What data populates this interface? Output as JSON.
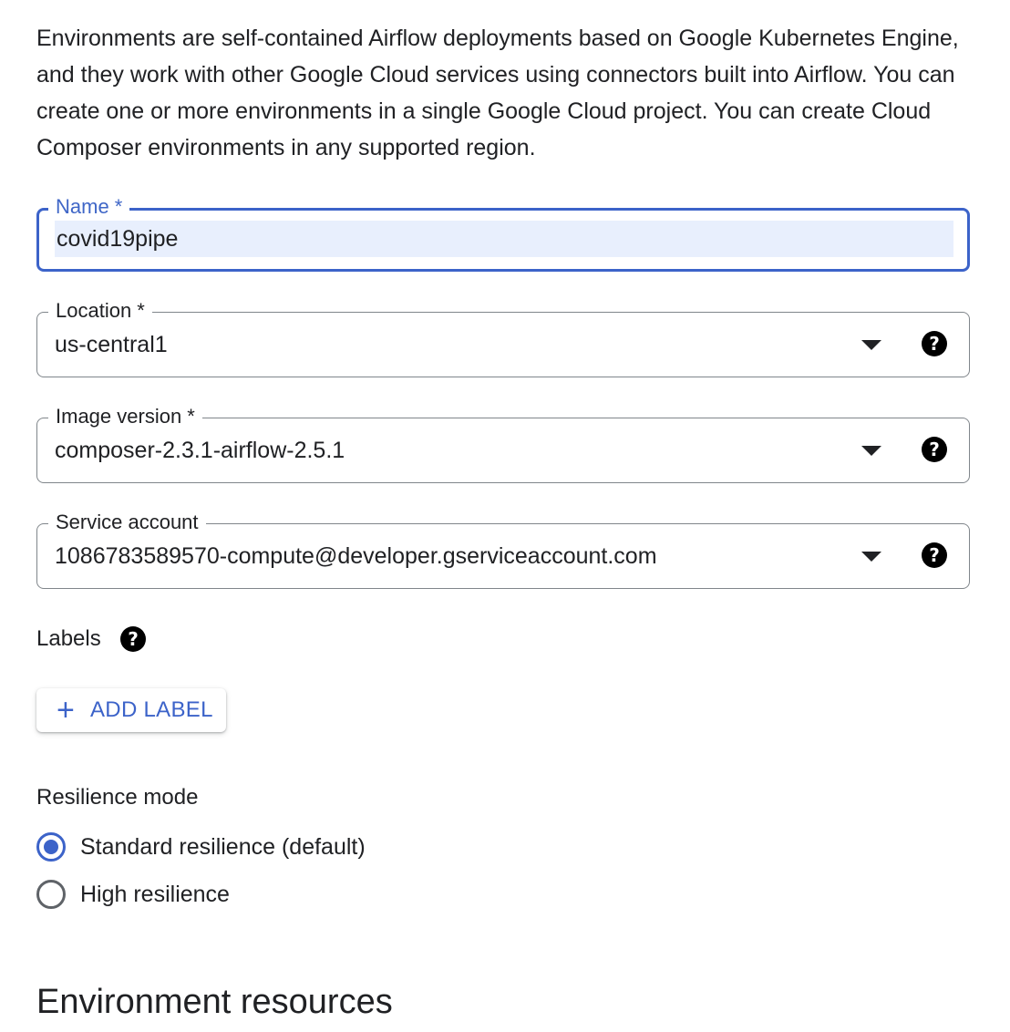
{
  "intro_text": "Environments are self-contained Airflow deployments based on Google Kubernetes Engine, and they work with other Google Cloud services using connectors built into Airflow. You can create one or more environments in a single Google Cloud project. You can create Cloud Composer environments in any supported region.",
  "fields": {
    "name": {
      "label": "Name *",
      "value": "covid19pipe",
      "focused": true,
      "accent_color": "#3c63c9"
    },
    "location": {
      "label": "Location *",
      "value": "us-central1",
      "icon": "dropdown-arrow-icon",
      "help_icon": "help-icon"
    },
    "image_version": {
      "label": "Image version *",
      "value": "composer-2.3.1-airflow-2.5.1",
      "icon": "dropdown-arrow-icon",
      "help_icon": "help-icon"
    },
    "service_account": {
      "label": "Service account",
      "value": "1086783589570-compute@developer.gserviceaccount.com",
      "icon": "dropdown-arrow-icon",
      "help_icon": "help-icon"
    }
  },
  "labels": {
    "heading": "Labels",
    "help_glyph": "?",
    "add_button_icon": "plus-icon",
    "add_button_plus": "+",
    "add_button_label": "ADD LABEL"
  },
  "resilience": {
    "heading": "Resilience mode",
    "options": [
      {
        "label": "Standard resilience (default)",
        "selected": true
      },
      {
        "label": "High resilience",
        "selected": false
      }
    ]
  },
  "section_heading": "Environment resources",
  "colors": {
    "accent": "#3c63c9",
    "text": "#202124",
    "border": "#80868b",
    "input_highlight": "#e8effd"
  }
}
